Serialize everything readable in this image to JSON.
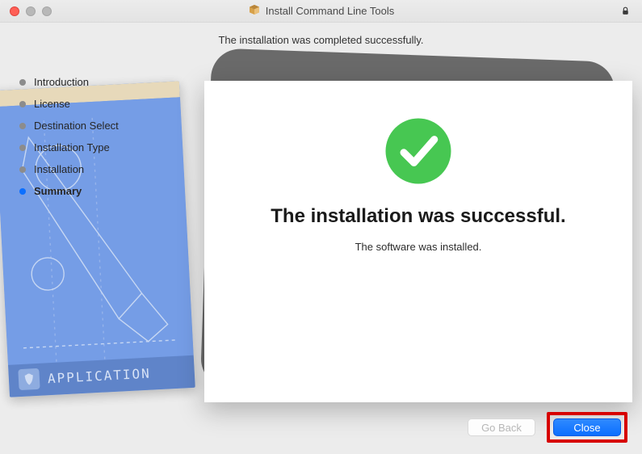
{
  "window": {
    "title": "Install Command Line Tools"
  },
  "headline": "The installation was completed successfully.",
  "steps": [
    {
      "label": "Introduction",
      "active": false
    },
    {
      "label": "License",
      "active": false
    },
    {
      "label": "Destination Select",
      "active": false
    },
    {
      "label": "Installation Type",
      "active": false
    },
    {
      "label": "Installation",
      "active": false
    },
    {
      "label": "Summary",
      "active": true
    }
  ],
  "panel": {
    "title": "The installation was successful.",
    "subtitle": "The software was installed."
  },
  "buttons": {
    "back": "Go Back",
    "close": "Close"
  },
  "colors": {
    "accent": "#0b6fff",
    "success": "#47c752",
    "highlight_box": "#d70000"
  }
}
